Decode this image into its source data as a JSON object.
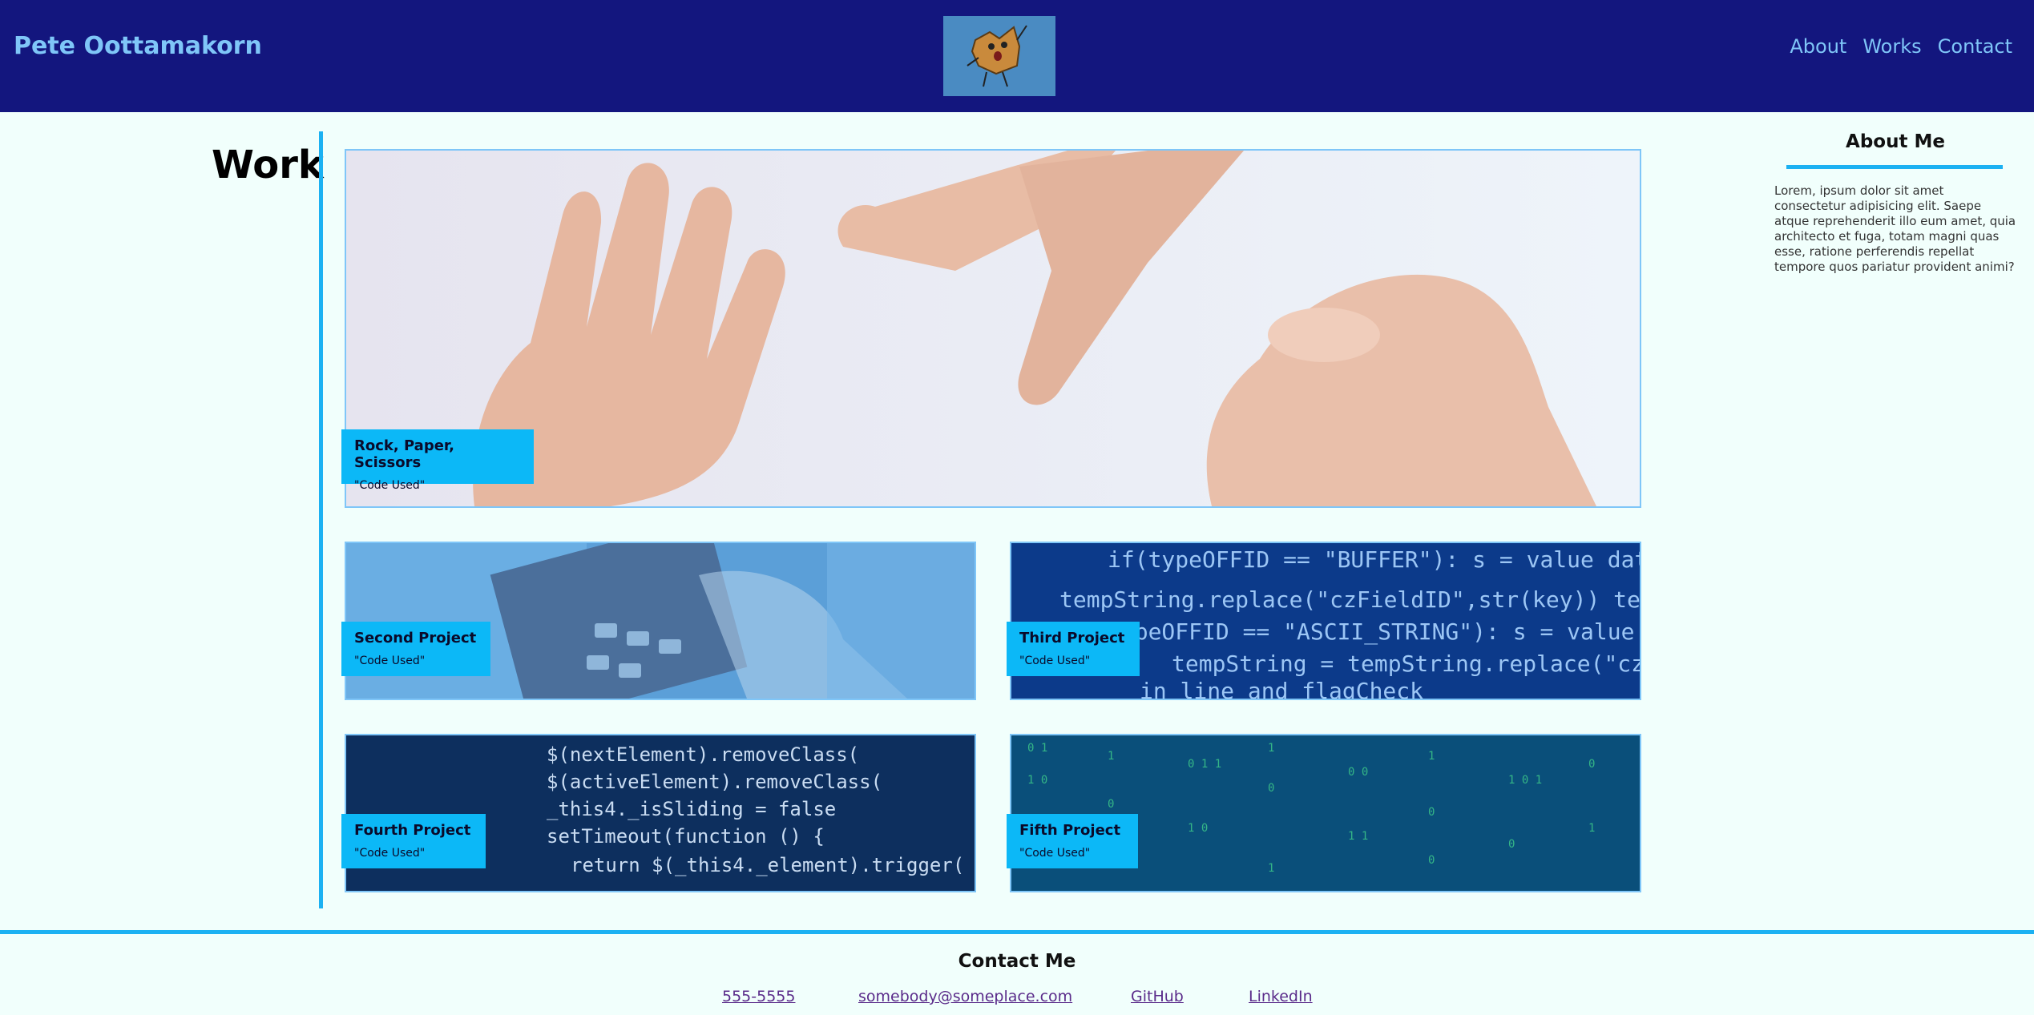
{
  "header": {
    "brand": "Pete Oottamakorn",
    "nav": [
      {
        "label": "About"
      },
      {
        "label": "Works"
      },
      {
        "label": "Contact"
      }
    ],
    "colors": {
      "background": "#13167e",
      "text": "#7fc6f8"
    }
  },
  "work": {
    "title": "Work",
    "projects": [
      {
        "title": "Rock, Paper, Scissors",
        "code": "\"Code Used\"",
        "image": "hands-rock-paper-scissors"
      },
      {
        "title": "Second Project",
        "code": "\"Code Used\"",
        "image": "calculator"
      },
      {
        "title": "Third Project",
        "code": "\"Code Used\"",
        "image": "code-screen-blue"
      },
      {
        "title": "Fourth Project",
        "code": "\"Code Used\"",
        "image": "code-screen-dark"
      },
      {
        "title": "Fifth Project",
        "code": "\"Code Used\"",
        "image": "matrix-binary"
      }
    ],
    "accent": "#1cb1f2",
    "label_bg": "#0cb8f7"
  },
  "about": {
    "title": "About Me",
    "text": "Lorem, ipsum dolor sit amet consectetur adipisicing elit. Saepe atque reprehenderit illo eum amet, quia architecto et fuga, totam magni quas esse, ratione perferendis repellat tempore quos pariatur provident animi?"
  },
  "footer": {
    "title": "Contact Me",
    "links": [
      {
        "label": "555-5555"
      },
      {
        "label": "somebody@someplace.com"
      },
      {
        "label": "GitHub"
      },
      {
        "label": "LinkedIn"
      }
    ]
  }
}
